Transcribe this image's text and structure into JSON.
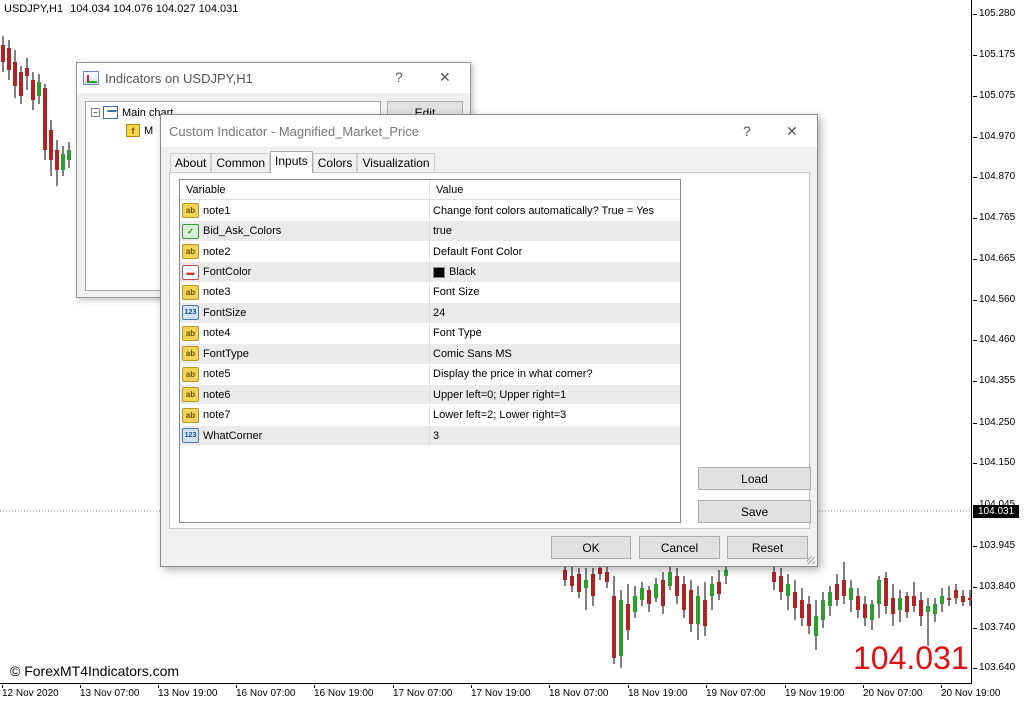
{
  "chart": {
    "header": {
      "symbol": "USDJPY,H1",
      "quote": "104.034 104.076 104.027 104.031"
    },
    "watermark": "© ForexMT4Indicators.com",
    "magnified_price": "104.031",
    "current_price": "104.031",
    "price_labels": [
      "105.280",
      "105.175",
      "105.075",
      "104.970",
      "104.870",
      "104.765",
      "104.665",
      "104.560",
      "104.460",
      "104.355",
      "104.250",
      "104.150",
      "104.045",
      "103.945",
      "103.840",
      "103.740",
      "103.640"
    ],
    "time_labels": [
      "12 Nov 2020",
      "13 Nov 07:00",
      "13 Nov 19:00",
      "16 Nov 07:00",
      "16 Nov 19:00",
      "17 Nov 07:00",
      "17 Nov 19:00",
      "18 Nov 07:00",
      "18 Nov 19:00",
      "19 Nov 07:00",
      "19 Nov 19:00",
      "20 Nov 07:00",
      "20 Nov 19:00"
    ],
    "colors": {
      "bull": "#2aa02a",
      "bear": "#b22222",
      "price_text": "#e01010"
    }
  },
  "indicators_dialog": {
    "title": "Indicators on USDJPY,H1",
    "help": "?",
    "close": "✕",
    "tree": {
      "root": "Main chart",
      "child": "M"
    },
    "edit_label": "Edit"
  },
  "custom_dialog": {
    "title": "Custom Indicator - Magnified_Market_Price",
    "help": "?",
    "close": "✕",
    "tabs": [
      "About",
      "Common",
      "Inputs",
      "Colors",
      "Visualization"
    ],
    "active_tab": "Inputs",
    "columns": {
      "variable": "Variable",
      "value": "Value"
    },
    "params": [
      {
        "type": "ab",
        "icon": "text-param-icon",
        "name": "note1",
        "value": "Change font colors automatically? True = Yes"
      },
      {
        "type": "bool",
        "icon": "bool-param-icon",
        "name": "Bid_Ask_Colors",
        "value": "true"
      },
      {
        "type": "ab",
        "icon": "text-param-icon",
        "name": "note2",
        "value": "Default Font Color"
      },
      {
        "type": "color",
        "icon": "color-param-icon",
        "name": "FontColor",
        "value": "Black"
      },
      {
        "type": "ab",
        "icon": "text-param-icon",
        "name": "note3",
        "value": "Font Size"
      },
      {
        "type": "num",
        "icon": "number-param-icon",
        "name": "FontSize",
        "value": "24"
      },
      {
        "type": "ab",
        "icon": "text-param-icon",
        "name": "note4",
        "value": "Font Type"
      },
      {
        "type": "ab",
        "icon": "text-param-icon",
        "name": "FontType",
        "value": "Comic Sans MS"
      },
      {
        "type": "ab",
        "icon": "text-param-icon",
        "name": "note5",
        "value": "Display the price in what corner?"
      },
      {
        "type": "ab",
        "icon": "text-param-icon",
        "name": "note6",
        "value": "Upper left=0; Upper right=1"
      },
      {
        "type": "ab",
        "icon": "text-param-icon",
        "name": "note7",
        "value": "Lower left=2; Lower right=3"
      },
      {
        "type": "num",
        "icon": "number-param-icon",
        "name": "WhatCorner",
        "value": "3"
      }
    ],
    "buttons": {
      "load": "Load",
      "save": "Save",
      "ok": "OK",
      "cancel": "Cancel",
      "reset": "Reset"
    }
  }
}
